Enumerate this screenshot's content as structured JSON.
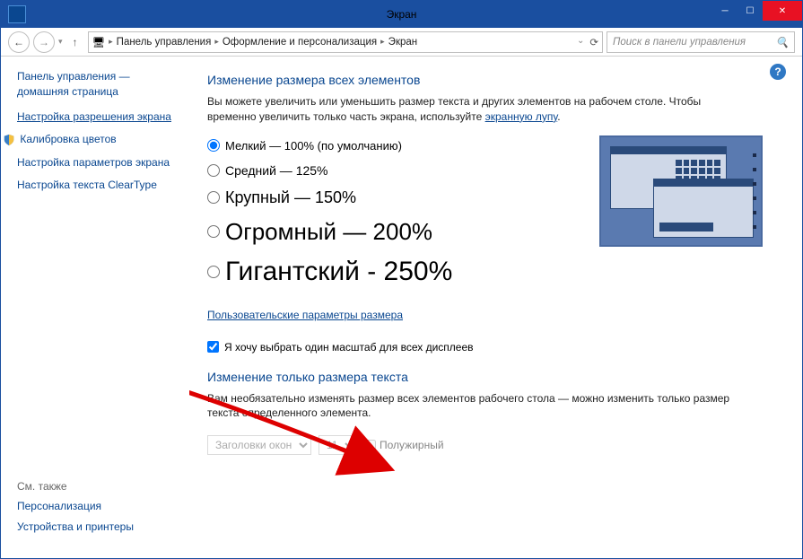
{
  "window": {
    "title": "Экран"
  },
  "toolbar": {
    "crumbs": [
      "Панель управления",
      "Оформление и персонализация",
      "Экран"
    ],
    "search_placeholder": "Поиск в панели управления"
  },
  "sidebar": {
    "home1": "Панель управления —",
    "home2": "домашняя страница",
    "links": [
      {
        "label": "Настройка разрешения экрана",
        "underline": true
      },
      {
        "label": "Калибровка цветов",
        "shield": true
      },
      {
        "label": "Настройка параметров экрана"
      },
      {
        "label": "Настройка текста ClearType"
      }
    ],
    "see_also": {
      "header": "См. также",
      "items": [
        "Персонализация",
        "Устройства и принтеры"
      ]
    }
  },
  "main": {
    "heading": "Изменение размера всех элементов",
    "desc_pre": "Вы можете увеличить или уменьшить размер текста и других элементов на рабочем столе. Чтобы временно увеличить только часть экрана, используйте ",
    "desc_link": "экранную лупу",
    "desc_post": ".",
    "options": [
      {
        "label": "Мелкий — 100% (по умолчанию)",
        "checked": true,
        "size": "s"
      },
      {
        "label": "Средний — 125%",
        "size": "m"
      },
      {
        "label": "Крупный — 150%",
        "size": "l"
      },
      {
        "label": "Огромный — 200%",
        "size": "xl"
      },
      {
        "label": "Гигантский - 250%",
        "size": "xxl"
      }
    ],
    "custom_link": "Пользовательские параметры размера",
    "checkbox": "Я хочу выбрать один масштаб для всех дисплеев",
    "section2": {
      "heading": "Изменение только размера текста",
      "desc": "Вам необязательно изменять размер всех элементов рабочего стола — можно изменить только размер текста определенного элемента.",
      "dd1": "Заголовки окон",
      "dd2": "11",
      "bold": "Полужирный"
    }
  }
}
